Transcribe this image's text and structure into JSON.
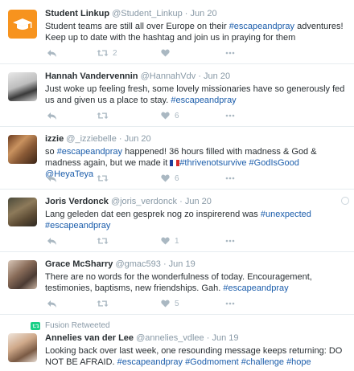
{
  "tweets": [
    {
      "name": "Student Linkup",
      "handle": "@Student_Linkup",
      "sep": "·",
      "time": "Jun 20",
      "text_a": "Student teams are still all over Europe on their ",
      "tag1": "#escapeandpray",
      "text_b": " adventures! Keep up to date with the hashtag and join us in praying for them",
      "retweets": "2",
      "likes": ""
    },
    {
      "name": "Hannah Vandervennin",
      "handle": "@HannahVdv",
      "sep": "·",
      "time": "Jun 20",
      "text_a": "Just woke up feeling fresh, some lovely missionaries have so generously fed us and given us a place to stay. ",
      "tag1": "#escapeandpray",
      "retweets": "",
      "likes": "6"
    },
    {
      "name": "izzie",
      "handle": "@_izziebelle",
      "sep": "·",
      "time": "Jun 20",
      "text_a": "so ",
      "tag1": "#escapeandpray",
      "text_b": " happened! 36 hours filled with madness & God & madness again, but we made it ",
      "tag2": "#thrivenotsurvive",
      "tag3": "#GodIsGood",
      "tag4": "@HeyaTeya",
      "retweets": "",
      "likes": "6"
    },
    {
      "name": "Joris Verdonck",
      "handle": "@joris_verdonck",
      "sep": "·",
      "time": "Jun 20",
      "text_a": "Lang geleden dat een gesprek nog zo inspirerend was ",
      "tag1": "#unexpected",
      "tag2": "#escapeandpray",
      "retweets": "",
      "likes": "1"
    },
    {
      "name": "Grace McSharry",
      "handle": "@gmac593",
      "sep": "·",
      "time": "Jun 19",
      "text_a": "There are no words for the wonderfulness of today. Encouragement, testimonies, baptisms, new friendships. Gah. ",
      "tag1": "#escapeandpray",
      "retweets": "",
      "likes": "5"
    },
    {
      "context": "Fusion Retweeted",
      "name": "Annelies van der Lee",
      "handle": "@annelies_vdlee",
      "sep": "·",
      "time": "Jun 19",
      "text_a": "Looking back over last week, one resounding message keeps returning: DO NOT BE AFRAID. ",
      "tag1": "#escapeandpray",
      "tag2": "#Godmoment",
      "tag3": "#challenge",
      "tag4": "#hope"
    }
  ],
  "colors": {
    "link": "#1b5dab",
    "muted": "#8899a6",
    "retweet_green": "#19cf86",
    "brand_orange": "#f7931e"
  },
  "icons": {
    "reply": "reply-icon",
    "retweet": "retweet-icon",
    "like": "heart-icon",
    "more": "more-dots-icon",
    "flag": "france-flag-icon"
  }
}
